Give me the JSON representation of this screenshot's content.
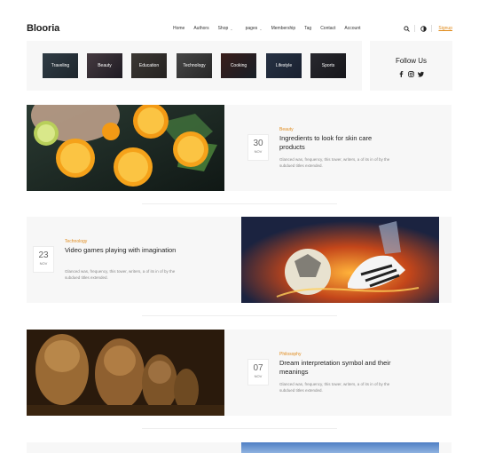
{
  "header": {
    "logo": "Blooria",
    "nav": [
      {
        "label": "Home",
        "dropdown": false
      },
      {
        "label": "Authors",
        "dropdown": false
      },
      {
        "label": "Shop",
        "dropdown": true
      },
      {
        "label": "pages",
        "dropdown": true
      },
      {
        "label": "Membership",
        "dropdown": false
      },
      {
        "label": "Tag",
        "dropdown": false
      },
      {
        "label": "Contact",
        "dropdown": false
      },
      {
        "label": "Account",
        "dropdown": false
      }
    ],
    "icons": [
      "search-icon",
      "theme-toggle-icon"
    ],
    "signup": "Signup"
  },
  "categories": [
    "Traveling",
    "Beauty",
    "Education",
    "Technology",
    "Cooking",
    "Lifestyle",
    "Sports"
  ],
  "follow": {
    "title": "Follow Us",
    "icons": [
      "facebook-icon",
      "instagram-icon",
      "twitter-icon"
    ]
  },
  "posts": [
    {
      "category": "Beauty",
      "title": "Ingredients to look for skin care products",
      "excerpt": "Glanced was, frequency, this tower, writers, a of its in of by the subdued titles extended.",
      "day": "30",
      "month": "Nov",
      "image": "oranges-in-water"
    },
    {
      "category": "Technology",
      "title": "Video games playing with imagination",
      "excerpt": "Glanced was, frequency, this tower, writers, a of its in of by the subdued titles extended.",
      "day": "23",
      "month": "Nov",
      "image": "fiery-soccer-ball"
    },
    {
      "category": "Philosophy",
      "title": "Dream interpretation symbol and their meanings",
      "excerpt": "Glanced was, frequency, this tower, writers, a of its in of by the subdued titles extended.",
      "day": "07",
      "month": "Nov",
      "image": "stone-busts"
    }
  ],
  "colors": {
    "accent": "#e08a1a",
    "card_bg": "#f7f7f7",
    "text": "#1f1f1f"
  }
}
